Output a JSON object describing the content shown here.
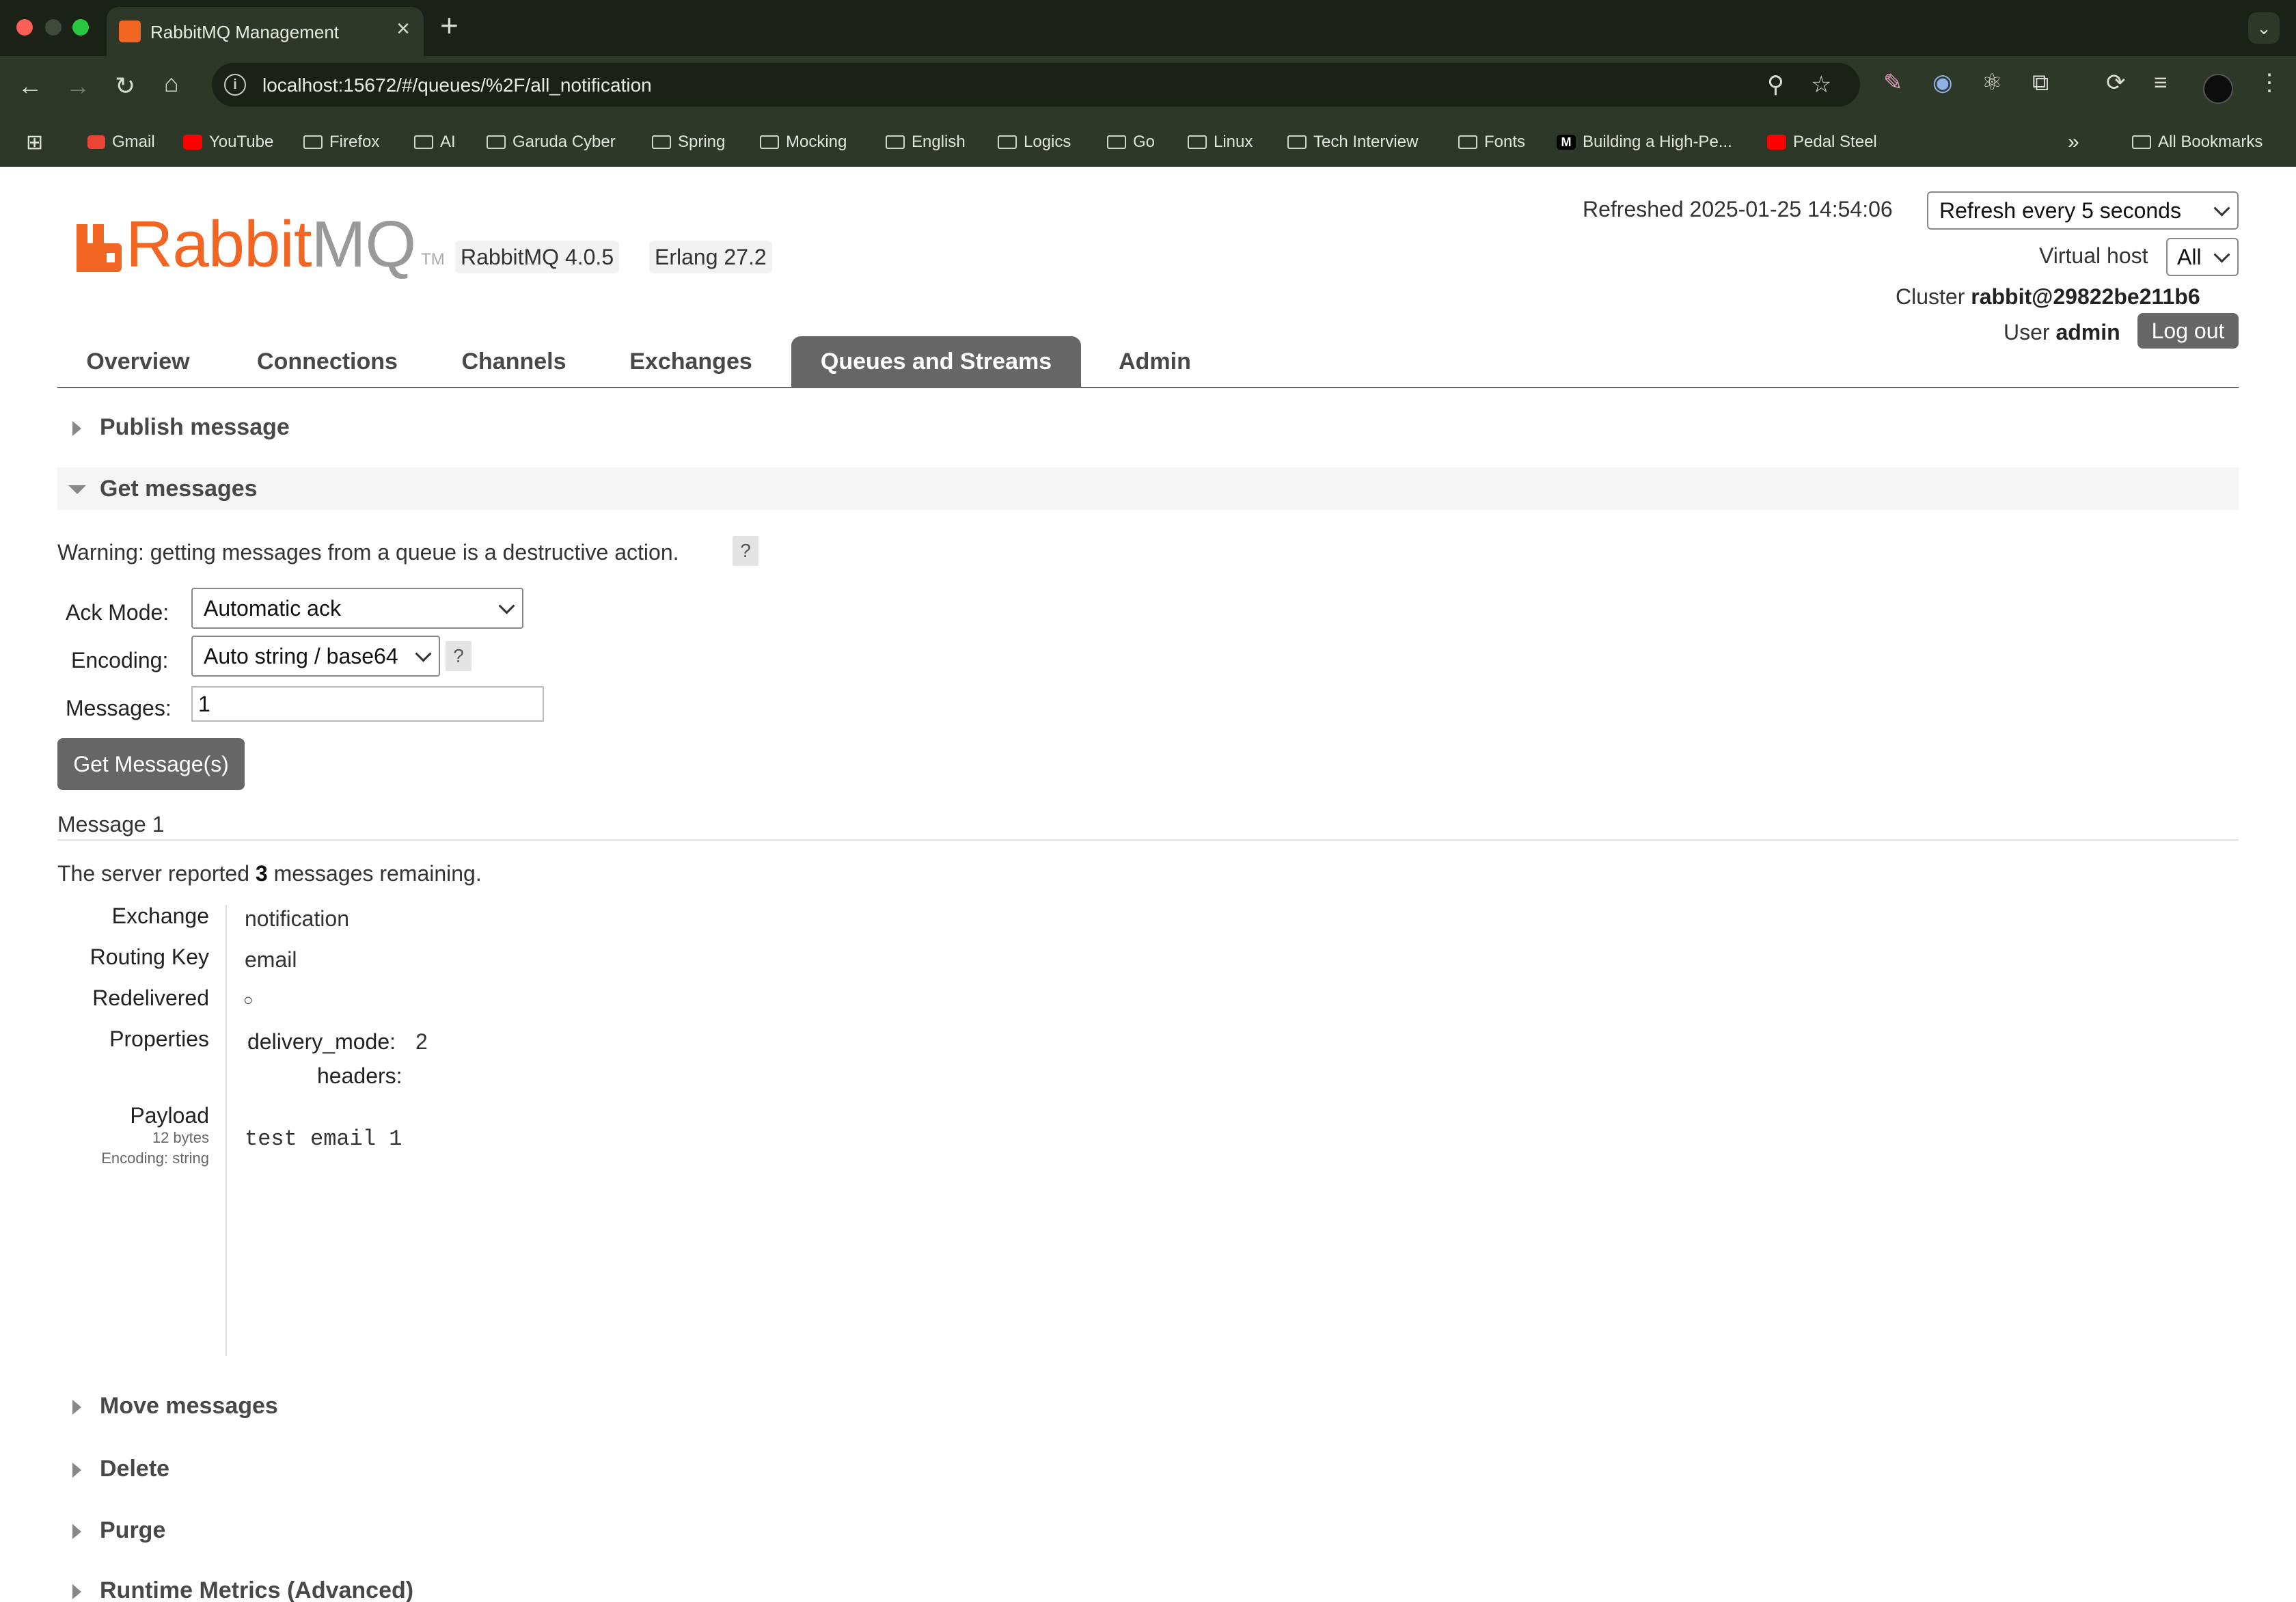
{
  "browser": {
    "tab_title": "RabbitMQ Management",
    "url": "localhost:15672/#/queues/%2F/all_notification",
    "bookmarks": [
      "Gmail",
      "YouTube",
      "Firefox",
      "AI",
      "Garuda Cyber",
      "Spring",
      "Mocking",
      "English",
      "Logics",
      "Go",
      "Linux",
      "Tech Interview",
      "Fonts",
      "Building a High-Pe...",
      "Pedal Steel"
    ],
    "all_bookmarks": "All Bookmarks",
    "bookmark_medium_badge": "M",
    "colors": {
      "frame": "#1a2116",
      "toolbar": "#2e3829"
    }
  },
  "header": {
    "logo_text": "RabbitMQ",
    "logo_tm": "TM",
    "version": "RabbitMQ 4.0.5",
    "erlang": "Erlang 27.2",
    "refreshed_label": "Refreshed",
    "refreshed_time": "2025-01-25 14:54:06",
    "refresh_select": "Refresh every 5 seconds",
    "vhost_label": "Virtual host",
    "vhost_value": "All",
    "cluster_label": "Cluster",
    "cluster_value": "rabbit@29822be211b6",
    "user_label": "User",
    "user_value": "admin",
    "logout": "Log out",
    "colors": {
      "brand_orange": "#f26522",
      "logo_grey": "#999999"
    }
  },
  "nav": {
    "tabs": [
      "Overview",
      "Connections",
      "Channels",
      "Exchanges",
      "Queues and Streams",
      "Admin"
    ],
    "active": "Queues and Streams"
  },
  "sections": {
    "publish": "Publish message",
    "get": "Get messages",
    "move": "Move messages",
    "delete": "Delete",
    "purge": "Purge",
    "runtime": "Runtime Metrics (Advanced)"
  },
  "get_form": {
    "warning": "Warning: getting messages from a queue is a destructive action.",
    "help": "?",
    "ack_label": "Ack Mode:",
    "ack_value": "Automatic ack",
    "enc_label": "Encoding:",
    "enc_value": "Auto string / base64",
    "msgs_label": "Messages:",
    "msgs_value": "1",
    "button": "Get Message(s)"
  },
  "message": {
    "title": "Message 1",
    "remaining_pre": "The server reported",
    "remaining_count": "3",
    "remaining_post": "messages remaining.",
    "exchange_label": "Exchange",
    "exchange_value": "notification",
    "routing_label": "Routing Key",
    "routing_value": "email",
    "redelivered_label": "Redelivered",
    "redelivered_value": "○",
    "properties_label": "Properties",
    "delivery_mode_label": "delivery_mode:",
    "delivery_mode_value": "2",
    "headers_label": "headers:",
    "payload_label": "Payload",
    "payload_size": "12 bytes",
    "payload_encoding": "Encoding: string",
    "payload_value": "test email 1"
  }
}
